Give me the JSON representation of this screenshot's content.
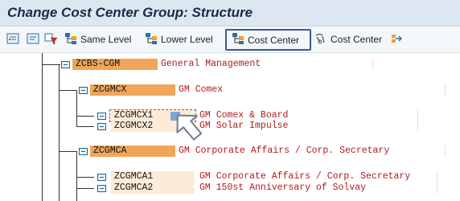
{
  "window": {
    "title": "Change Cost Center Group: Structure"
  },
  "toolbar": {
    "items": [
      {
        "label": "",
        "icon": "expand-tree-icon"
      },
      {
        "label": "",
        "icon": "collapse-tree-icon"
      },
      {
        "label": "",
        "icon": "filter-icon"
      },
      {
        "label": "Same Level",
        "icon": "hierarchy-icon"
      },
      {
        "label": "Lower Level",
        "icon": "hierarchy-icon"
      },
      {
        "label": "Cost Center",
        "icon": "hierarchy-icon",
        "active": true
      },
      {
        "label": "Cost Center",
        "icon": "structure-icon"
      },
      {
        "label": "",
        "icon": "move-icon"
      }
    ]
  },
  "tree": {
    "root": {
      "code": "ZCBS-CGM",
      "description": "General Management"
    },
    "groups": [
      {
        "code": "ZCGMCX",
        "description": "GM Comex",
        "children": [
          {
            "code": "ZCGMCX1",
            "description": "GM Comex & Board"
          },
          {
            "code": "ZCGMCX2",
            "description": "GM Solar Impulse"
          }
        ]
      },
      {
        "code": "ZCGMCA",
        "description": "GM Corporate Affairs / Corp. Secretary",
        "children": [
          {
            "code": "ZCGMCA1",
            "description": "GM Corporate Affairs / Corp. Secretary"
          },
          {
            "code": "ZCGMCA2",
            "description": "GM 150st Anniversary of Solvay"
          }
        ]
      }
    ]
  },
  "colors": {
    "accent": "#3a5a94",
    "group_highlight": "#f0a55a",
    "leaf_highlight": "#fcebd8",
    "description_text": "#b11a1a"
  }
}
